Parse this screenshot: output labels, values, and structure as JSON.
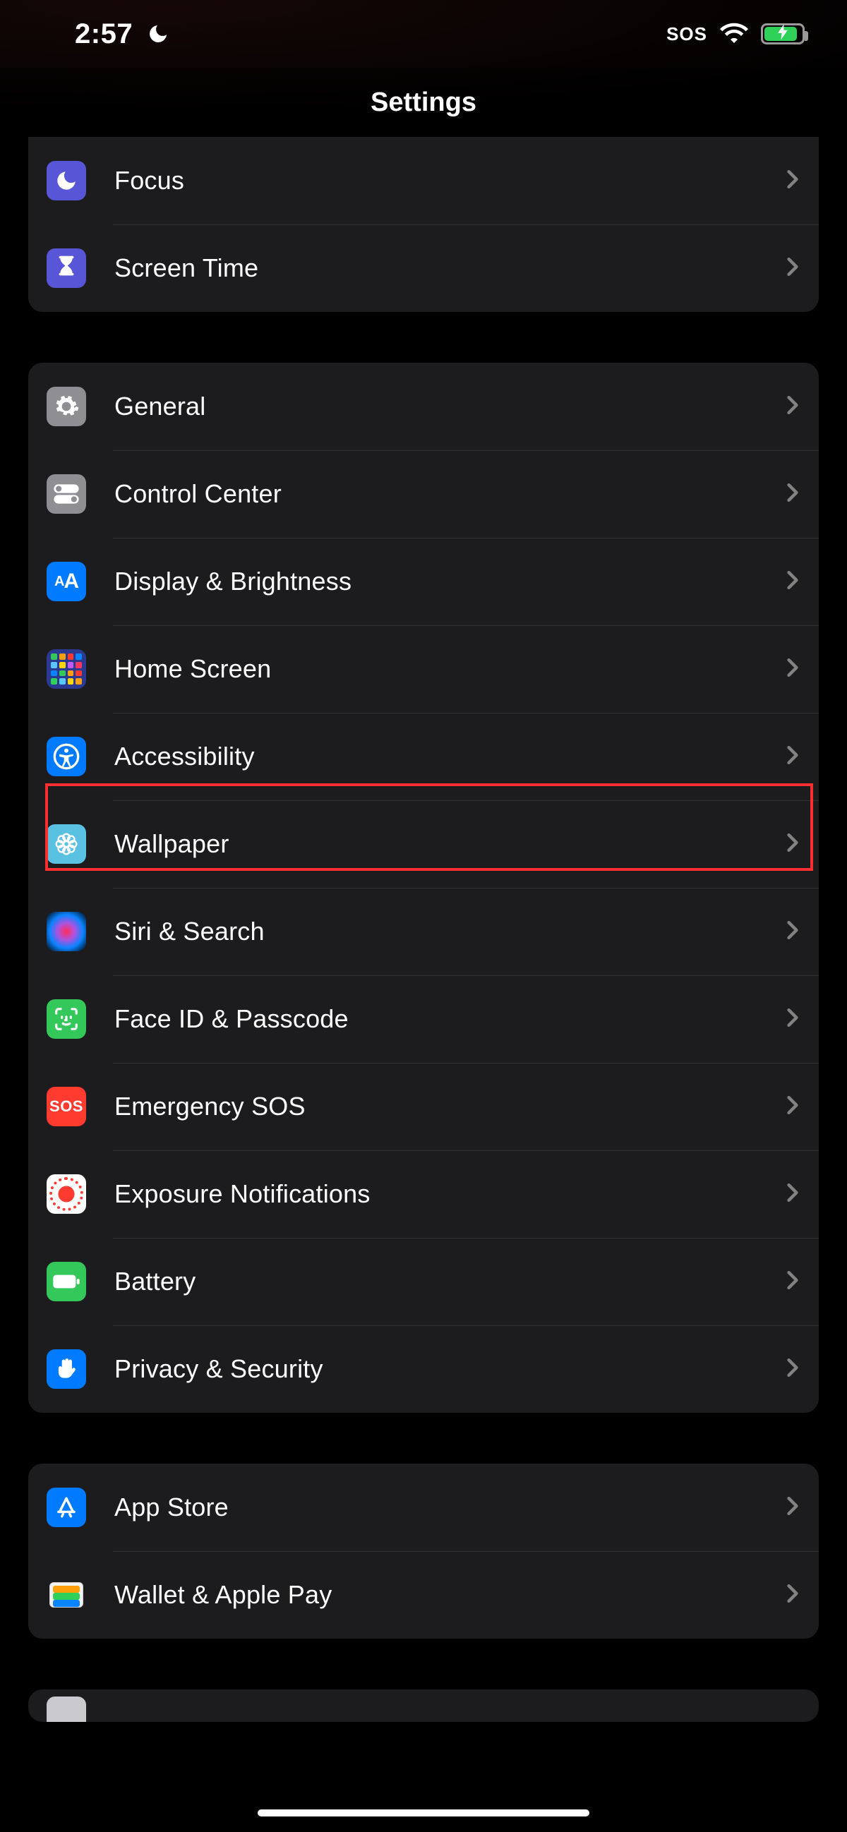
{
  "statusbar": {
    "time": "2:57",
    "sos": "SOS"
  },
  "nav": {
    "title": "Settings"
  },
  "groups": [
    {
      "rows": [
        {
          "key": "focus",
          "label": "Focus"
        },
        {
          "key": "screen-time",
          "label": "Screen Time"
        }
      ]
    },
    {
      "rows": [
        {
          "key": "general",
          "label": "General"
        },
        {
          "key": "control-center",
          "label": "Control Center"
        },
        {
          "key": "display-brightness",
          "label": "Display & Brightness"
        },
        {
          "key": "home-screen",
          "label": "Home Screen"
        },
        {
          "key": "accessibility",
          "label": "Accessibility"
        },
        {
          "key": "wallpaper",
          "label": "Wallpaper"
        },
        {
          "key": "siri-search",
          "label": "Siri & Search"
        },
        {
          "key": "faceid-passcode",
          "label": "Face ID & Passcode"
        },
        {
          "key": "emergency-sos",
          "label": "Emergency SOS"
        },
        {
          "key": "exposure-notifications",
          "label": "Exposure Notifications"
        },
        {
          "key": "battery",
          "label": "Battery"
        },
        {
          "key": "privacy-security",
          "label": "Privacy & Security"
        }
      ]
    },
    {
      "rows": [
        {
          "key": "app-store",
          "label": "App Store"
        },
        {
          "key": "wallet-applepay",
          "label": "Wallet & Apple Pay"
        }
      ]
    }
  ],
  "annotation": {
    "highlighted_row_key": "accessibility"
  }
}
